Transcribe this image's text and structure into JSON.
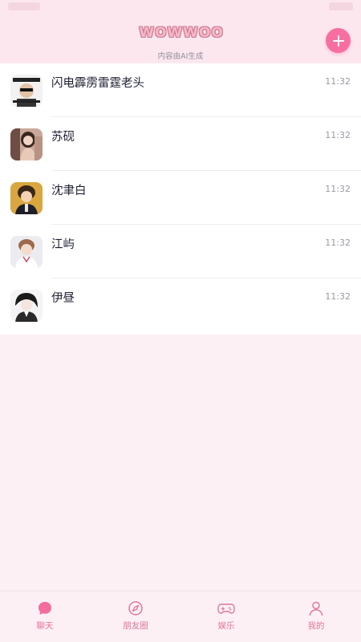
{
  "app": {
    "logo_text": "WOWWOO",
    "subtitle": "内容由AI生成",
    "accent_color": "#f76fa0"
  },
  "chats": [
    {
      "name": "闪电霹雳雷霆老头",
      "time": "11:32",
      "avatar": "avatar-sunglasses-icon"
    },
    {
      "name": "苏砚",
      "time": "11:32",
      "avatar": "avatar-woman-icon"
    },
    {
      "name": "沈聿白",
      "time": "11:32",
      "avatar": "avatar-man-suit-icon"
    },
    {
      "name": "江屿",
      "time": "11:32",
      "avatar": "avatar-man-light-icon"
    },
    {
      "name": "伊昼",
      "time": "11:32",
      "avatar": "avatar-man-dark-icon"
    }
  ],
  "nav": {
    "items": [
      {
        "label": "聊天",
        "icon": "chat-bubble-icon",
        "active": true
      },
      {
        "label": "朋友圈",
        "icon": "compass-icon",
        "active": false
      },
      {
        "label": "娱乐",
        "icon": "gamepad-icon",
        "active": false
      },
      {
        "label": "我的",
        "icon": "person-icon",
        "active": false
      }
    ]
  }
}
